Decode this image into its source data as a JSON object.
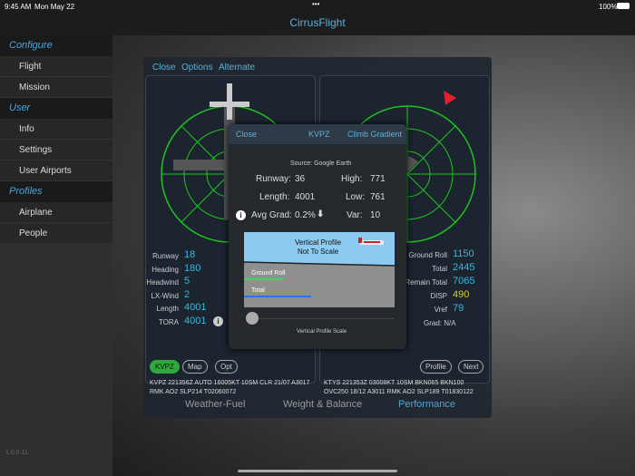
{
  "status": {
    "time": "9:45 AM",
    "date": "Mon May 22",
    "battery": "100%"
  },
  "app_title": "CirrusFlight",
  "sidebar": {
    "sections": [
      {
        "label": "Configure",
        "items": [
          "Flight",
          "Mission"
        ]
      },
      {
        "label": "User",
        "items": [
          "Info",
          "Settings",
          "User Airports"
        ]
      },
      {
        "label": "Profiles",
        "items": [
          "Airplane",
          "People"
        ]
      }
    ]
  },
  "version": "1.0.0.11",
  "panel": {
    "close": "Close",
    "options": "Options",
    "alternate": "Alternate",
    "left": {
      "rows": [
        {
          "label": "Runway",
          "value": "18"
        },
        {
          "label": "Heading",
          "value": "180"
        },
        {
          "label": "Headwind",
          "value": "5"
        },
        {
          "label": "LX-Wind",
          "value": "2"
        },
        {
          "label": "Length",
          "value": "4001"
        },
        {
          "label": "TORA",
          "value": "4001"
        }
      ],
      "airport_btn": "KVPZ",
      "map_btn": "Map",
      "opt_btn": "Opt",
      "metar": "KVPZ 221356Z AUTO 16005KT 10SM CLR 21/07 A3017 RMK AO2 SLP214 T02060072"
    },
    "right": {
      "rows": [
        {
          "label": "Ground Roll",
          "value": "1150",
          "color": "#3cb8d8"
        },
        {
          "label": "Total",
          "value": "2445",
          "color": "#3cb8d8"
        },
        {
          "label": "Remain Total",
          "value": "7065",
          "color": "#3cb8d8"
        },
        {
          "label": "DISP",
          "value": "490",
          "color": "#d8c83c"
        },
        {
          "label": "Vref",
          "value": "79",
          "color": "#3cb8d8"
        }
      ],
      "grad": "Grad: N/A",
      "profile_btn": "Profile",
      "next_btn": "Next",
      "metar": "KTYS 221353Z 03008KT 10SM BKN065 BKN100 OVC250 18/12 A3011 RMK AO2 SLP189 T01830122"
    },
    "tabs": [
      "Weather-Fuel",
      "Weight & Balance",
      "Performance"
    ],
    "active_tab": 2
  },
  "popup": {
    "close": "Close",
    "title": "KVPZ",
    "action": "Climb Gradient",
    "source": "Source: Google Earth",
    "runway_label": "Runway:",
    "runway": "36",
    "high_label": "High:",
    "high": "771",
    "length_label": "Length:",
    "length": "4001",
    "low_label": "Low:",
    "low": "761",
    "grad_label": "Avg Grad:",
    "grad": "0.2%",
    "var_label": "Var:",
    "var": "10",
    "profile_title": "Vertical Profile",
    "profile_sub": "Not To Scale",
    "ground_roll": "Ground Roll",
    "total": "Total",
    "scale_label": "Vertical Profile Scale",
    "scale_value": 0
  }
}
